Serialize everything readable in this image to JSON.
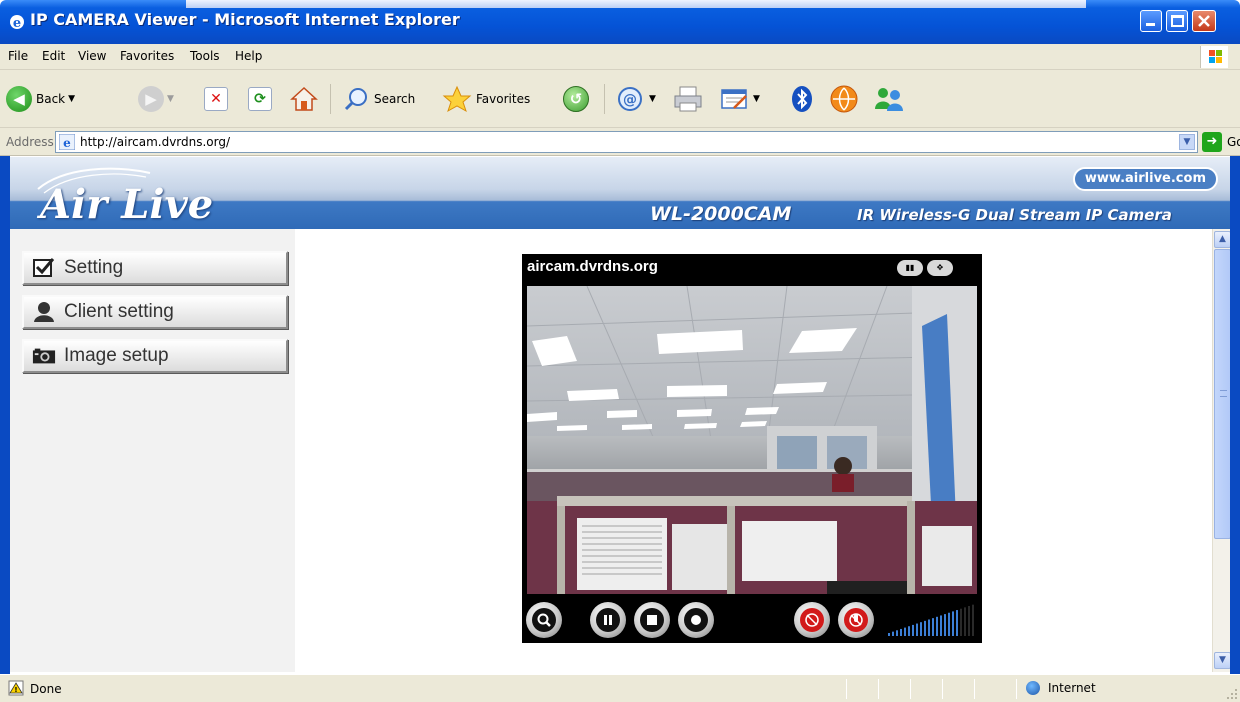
{
  "window": {
    "title": "IP CAMERA Viewer - Microsoft Internet Explorer",
    "controls": [
      "minimize",
      "maximize",
      "close"
    ]
  },
  "menu": {
    "items": [
      "File",
      "Edit",
      "View",
      "Favorites",
      "Tools",
      "Help"
    ]
  },
  "toolbar": {
    "back_label": "Back",
    "search_label": "Search",
    "favorites_label": "Favorites"
  },
  "address": {
    "label": "Address",
    "url": "http://aircam.dvrdns.org/",
    "go_label": "Go"
  },
  "banner": {
    "logo": "Air Live",
    "website": "www.airlive.com",
    "model": "WL-2000CAM",
    "description": "IR Wireless-G Dual Stream IP Camera"
  },
  "nav": {
    "items": [
      {
        "label": "Setting",
        "icon": "checkbox-icon"
      },
      {
        "label": "Client setting",
        "icon": "user-icon"
      },
      {
        "label": "Image setup",
        "icon": "camera-icon"
      }
    ]
  },
  "viewer": {
    "caption": "aircam.dvrdns.org",
    "volume_level": 0.8
  },
  "status": {
    "text": "Done",
    "zone": "Internet"
  },
  "colors": {
    "titlebar": "#0553d6",
    "banner_blue": "#2f6ab7",
    "chrome": "#ece9d8"
  }
}
